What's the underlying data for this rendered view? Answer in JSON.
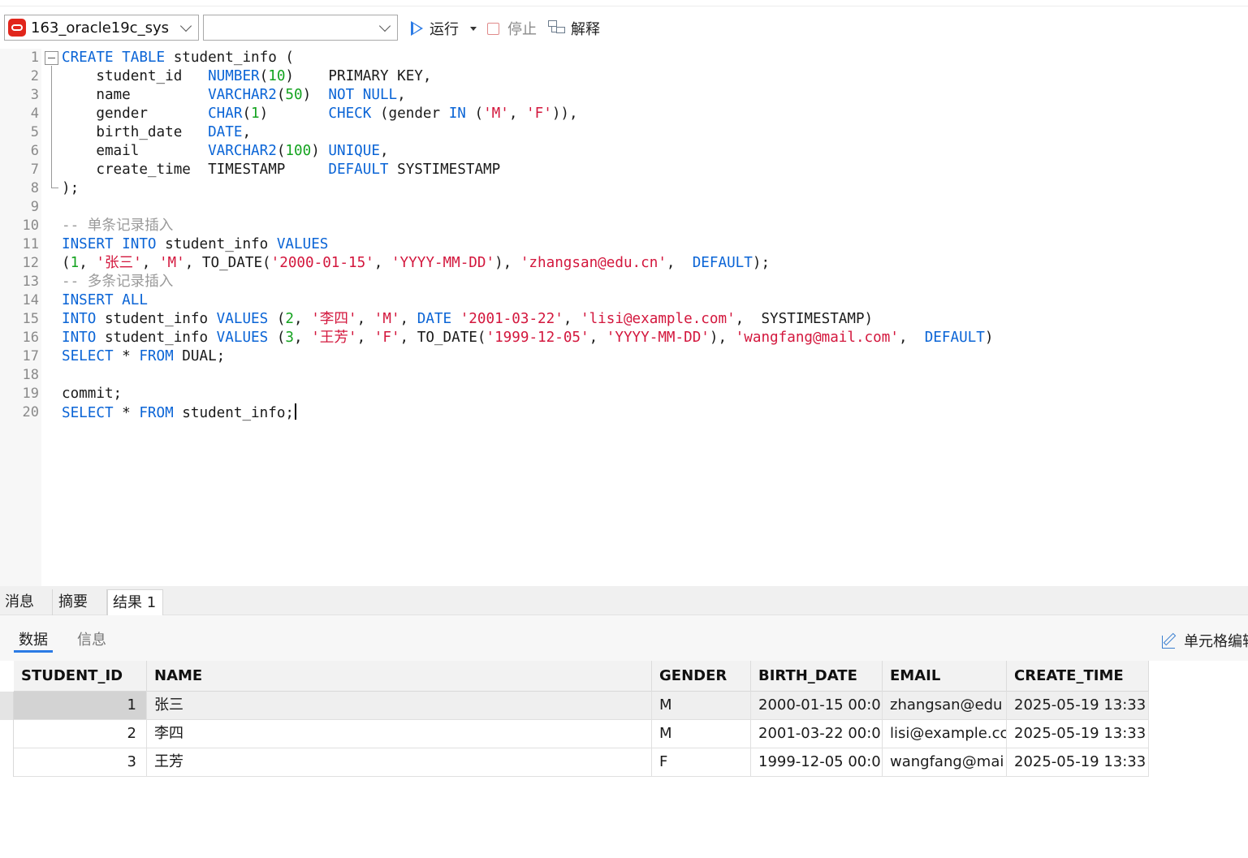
{
  "toolbar": {
    "connection": "163_oracle19c_sys",
    "database": "",
    "run_label": "运行",
    "stop_label": "停止",
    "explain_label": "解释"
  },
  "editor": {
    "line_numbers": [
      "1",
      "2",
      "3",
      "4",
      "5",
      "6",
      "7",
      "8",
      "9",
      "10",
      "11",
      "12",
      "13",
      "14",
      "15",
      "16",
      "17",
      "18",
      "19",
      "20"
    ],
    "lines": [
      [
        {
          "t": "kw",
          "v": "CREATE TABLE"
        },
        {
          "t": "p",
          "v": " student_info ("
        }
      ],
      [
        {
          "t": "p",
          "v": "    student_id   "
        },
        {
          "t": "kw",
          "v": "NUMBER"
        },
        {
          "t": "p",
          "v": "("
        },
        {
          "t": "num",
          "v": "10"
        },
        {
          "t": "p",
          "v": ")    PRIMARY KEY,"
        }
      ],
      [
        {
          "t": "p",
          "v": "    name         "
        },
        {
          "t": "kw",
          "v": "VARCHAR2"
        },
        {
          "t": "p",
          "v": "("
        },
        {
          "t": "num",
          "v": "50"
        },
        {
          "t": "p",
          "v": ")  "
        },
        {
          "t": "kw",
          "v": "NOT NULL"
        },
        {
          "t": "p",
          "v": ","
        }
      ],
      [
        {
          "t": "p",
          "v": "    gender       "
        },
        {
          "t": "kw",
          "v": "CHAR"
        },
        {
          "t": "p",
          "v": "("
        },
        {
          "t": "num",
          "v": "1"
        },
        {
          "t": "p",
          "v": ")       "
        },
        {
          "t": "kw",
          "v": "CHECK"
        },
        {
          "t": "p",
          "v": " (gender "
        },
        {
          "t": "kw",
          "v": "IN"
        },
        {
          "t": "p",
          "v": " ("
        },
        {
          "t": "str",
          "v": "'M'"
        },
        {
          "t": "p",
          "v": ", "
        },
        {
          "t": "str",
          "v": "'F'"
        },
        {
          "t": "p",
          "v": ")),"
        }
      ],
      [
        {
          "t": "p",
          "v": "    birth_date   "
        },
        {
          "t": "kw",
          "v": "DATE"
        },
        {
          "t": "p",
          "v": ","
        }
      ],
      [
        {
          "t": "p",
          "v": "    email        "
        },
        {
          "t": "kw",
          "v": "VARCHAR2"
        },
        {
          "t": "p",
          "v": "("
        },
        {
          "t": "num",
          "v": "100"
        },
        {
          "t": "p",
          "v": ") "
        },
        {
          "t": "kw",
          "v": "UNIQUE"
        },
        {
          "t": "p",
          "v": ","
        }
      ],
      [
        {
          "t": "p",
          "v": "    create_time  TIMESTAMP     "
        },
        {
          "t": "kw",
          "v": "DEFAULT"
        },
        {
          "t": "p",
          "v": " SYSTIMESTAMP"
        }
      ],
      [
        {
          "t": "p",
          "v": ");"
        }
      ],
      [],
      [
        {
          "t": "cmt",
          "v": "-- 单条记录插入"
        }
      ],
      [
        {
          "t": "kw",
          "v": "INSERT INTO"
        },
        {
          "t": "p",
          "v": " student_info "
        },
        {
          "t": "kw",
          "v": "VALUES"
        }
      ],
      [
        {
          "t": "p",
          "v": "("
        },
        {
          "t": "num",
          "v": "1"
        },
        {
          "t": "p",
          "v": ", "
        },
        {
          "t": "str",
          "v": "'张三'"
        },
        {
          "t": "p",
          "v": ", "
        },
        {
          "t": "str",
          "v": "'M'"
        },
        {
          "t": "p",
          "v": ", TO_DATE("
        },
        {
          "t": "str",
          "v": "'2000-01-15'"
        },
        {
          "t": "p",
          "v": ", "
        },
        {
          "t": "str",
          "v": "'YYYY-MM-DD'"
        },
        {
          "t": "p",
          "v": "), "
        },
        {
          "t": "str",
          "v": "'zhangsan@edu.cn'"
        },
        {
          "t": "p",
          "v": ",  "
        },
        {
          "t": "kw",
          "v": "DEFAULT"
        },
        {
          "t": "p",
          "v": ");"
        }
      ],
      [
        {
          "t": "cmt",
          "v": "-- 多条记录插入"
        }
      ],
      [
        {
          "t": "kw",
          "v": "INSERT ALL"
        }
      ],
      [
        {
          "t": "kw",
          "v": "INTO"
        },
        {
          "t": "p",
          "v": " student_info "
        },
        {
          "t": "kw",
          "v": "VALUES"
        },
        {
          "t": "p",
          "v": " ("
        },
        {
          "t": "num",
          "v": "2"
        },
        {
          "t": "p",
          "v": ", "
        },
        {
          "t": "str",
          "v": "'李四'"
        },
        {
          "t": "p",
          "v": ", "
        },
        {
          "t": "str",
          "v": "'M'"
        },
        {
          "t": "p",
          "v": ", "
        },
        {
          "t": "kw",
          "v": "DATE"
        },
        {
          "t": "p",
          "v": " "
        },
        {
          "t": "str",
          "v": "'2001-03-22'"
        },
        {
          "t": "p",
          "v": ", "
        },
        {
          "t": "str",
          "v": "'lisi@example.com'"
        },
        {
          "t": "p",
          "v": ",  SYSTIMESTAMP)"
        }
      ],
      [
        {
          "t": "kw",
          "v": "INTO"
        },
        {
          "t": "p",
          "v": " student_info "
        },
        {
          "t": "kw",
          "v": "VALUES"
        },
        {
          "t": "p",
          "v": " ("
        },
        {
          "t": "num",
          "v": "3"
        },
        {
          "t": "p",
          "v": ", "
        },
        {
          "t": "str",
          "v": "'王芳'"
        },
        {
          "t": "p",
          "v": ", "
        },
        {
          "t": "str",
          "v": "'F'"
        },
        {
          "t": "p",
          "v": ", TO_DATE("
        },
        {
          "t": "str",
          "v": "'1999-12-05'"
        },
        {
          "t": "p",
          "v": ", "
        },
        {
          "t": "str",
          "v": "'YYYY-MM-DD'"
        },
        {
          "t": "p",
          "v": "), "
        },
        {
          "t": "str",
          "v": "'wangfang@mail.com'"
        },
        {
          "t": "p",
          "v": ",  "
        },
        {
          "t": "kw",
          "v": "DEFAULT"
        },
        {
          "t": "p",
          "v": ")"
        }
      ],
      [
        {
          "t": "kw",
          "v": "SELECT"
        },
        {
          "t": "p",
          "v": " * "
        },
        {
          "t": "kw",
          "v": "FROM"
        },
        {
          "t": "p",
          "v": " DUAL;"
        }
      ],
      [],
      [
        {
          "t": "p",
          "v": "commit;"
        }
      ],
      [
        {
          "t": "kw",
          "v": "SELECT"
        },
        {
          "t": "p",
          "v": " * "
        },
        {
          "t": "kw",
          "v": "FROM"
        },
        {
          "t": "p",
          "v": " student_info;"
        }
      ]
    ]
  },
  "result_tabs": [
    "消息",
    "摘要",
    "结果 1"
  ],
  "sub_tabs": [
    "数据",
    "信息"
  ],
  "cell_edit_label": "单元格编辑",
  "grid": {
    "columns": [
      "STUDENT_ID",
      "NAME",
      "GENDER",
      "BIRTH_DATE",
      "EMAIL",
      "CREATE_TIME"
    ],
    "rows": [
      [
        "1",
        "张三",
        "M",
        "2000-01-15 00:0",
        "zhangsan@edu",
        "2025-05-19 13:33"
      ],
      [
        "2",
        "李四",
        "M",
        "2001-03-22 00:0",
        "lisi@example.cc",
        "2025-05-19 13:33"
      ],
      [
        "3",
        "王芳",
        "F",
        "1999-12-05 00:0",
        "wangfang@mai",
        "2025-05-19 13:33"
      ]
    ]
  }
}
